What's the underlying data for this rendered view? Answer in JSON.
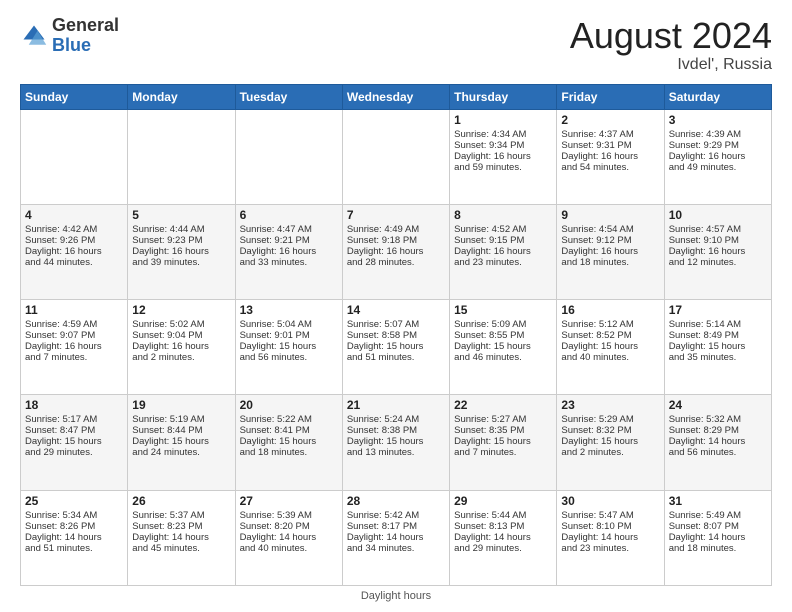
{
  "logo": {
    "general": "General",
    "blue": "Blue"
  },
  "header": {
    "month_year": "August 2024",
    "location": "Ivdel', Russia"
  },
  "footer": {
    "note": "Daylight hours"
  },
  "days_of_week": [
    "Sunday",
    "Monday",
    "Tuesday",
    "Wednesday",
    "Thursday",
    "Friday",
    "Saturday"
  ],
  "weeks": [
    [
      {
        "day": "",
        "info": ""
      },
      {
        "day": "",
        "info": ""
      },
      {
        "day": "",
        "info": ""
      },
      {
        "day": "",
        "info": ""
      },
      {
        "day": "1",
        "info": "Sunrise: 4:34 AM\nSunset: 9:34 PM\nDaylight: 16 hours\nand 59 minutes."
      },
      {
        "day": "2",
        "info": "Sunrise: 4:37 AM\nSunset: 9:31 PM\nDaylight: 16 hours\nand 54 minutes."
      },
      {
        "day": "3",
        "info": "Sunrise: 4:39 AM\nSunset: 9:29 PM\nDaylight: 16 hours\nand 49 minutes."
      }
    ],
    [
      {
        "day": "4",
        "info": "Sunrise: 4:42 AM\nSunset: 9:26 PM\nDaylight: 16 hours\nand 44 minutes."
      },
      {
        "day": "5",
        "info": "Sunrise: 4:44 AM\nSunset: 9:23 PM\nDaylight: 16 hours\nand 39 minutes."
      },
      {
        "day": "6",
        "info": "Sunrise: 4:47 AM\nSunset: 9:21 PM\nDaylight: 16 hours\nand 33 minutes."
      },
      {
        "day": "7",
        "info": "Sunrise: 4:49 AM\nSunset: 9:18 PM\nDaylight: 16 hours\nand 28 minutes."
      },
      {
        "day": "8",
        "info": "Sunrise: 4:52 AM\nSunset: 9:15 PM\nDaylight: 16 hours\nand 23 minutes."
      },
      {
        "day": "9",
        "info": "Sunrise: 4:54 AM\nSunset: 9:12 PM\nDaylight: 16 hours\nand 18 minutes."
      },
      {
        "day": "10",
        "info": "Sunrise: 4:57 AM\nSunset: 9:10 PM\nDaylight: 16 hours\nand 12 minutes."
      }
    ],
    [
      {
        "day": "11",
        "info": "Sunrise: 4:59 AM\nSunset: 9:07 PM\nDaylight: 16 hours\nand 7 minutes."
      },
      {
        "day": "12",
        "info": "Sunrise: 5:02 AM\nSunset: 9:04 PM\nDaylight: 16 hours\nand 2 minutes."
      },
      {
        "day": "13",
        "info": "Sunrise: 5:04 AM\nSunset: 9:01 PM\nDaylight: 15 hours\nand 56 minutes."
      },
      {
        "day": "14",
        "info": "Sunrise: 5:07 AM\nSunset: 8:58 PM\nDaylight: 15 hours\nand 51 minutes."
      },
      {
        "day": "15",
        "info": "Sunrise: 5:09 AM\nSunset: 8:55 PM\nDaylight: 15 hours\nand 46 minutes."
      },
      {
        "day": "16",
        "info": "Sunrise: 5:12 AM\nSunset: 8:52 PM\nDaylight: 15 hours\nand 40 minutes."
      },
      {
        "day": "17",
        "info": "Sunrise: 5:14 AM\nSunset: 8:49 PM\nDaylight: 15 hours\nand 35 minutes."
      }
    ],
    [
      {
        "day": "18",
        "info": "Sunrise: 5:17 AM\nSunset: 8:47 PM\nDaylight: 15 hours\nand 29 minutes."
      },
      {
        "day": "19",
        "info": "Sunrise: 5:19 AM\nSunset: 8:44 PM\nDaylight: 15 hours\nand 24 minutes."
      },
      {
        "day": "20",
        "info": "Sunrise: 5:22 AM\nSunset: 8:41 PM\nDaylight: 15 hours\nand 18 minutes."
      },
      {
        "day": "21",
        "info": "Sunrise: 5:24 AM\nSunset: 8:38 PM\nDaylight: 15 hours\nand 13 minutes."
      },
      {
        "day": "22",
        "info": "Sunrise: 5:27 AM\nSunset: 8:35 PM\nDaylight: 15 hours\nand 7 minutes."
      },
      {
        "day": "23",
        "info": "Sunrise: 5:29 AM\nSunset: 8:32 PM\nDaylight: 15 hours\nand 2 minutes."
      },
      {
        "day": "24",
        "info": "Sunrise: 5:32 AM\nSunset: 8:29 PM\nDaylight: 14 hours\nand 56 minutes."
      }
    ],
    [
      {
        "day": "25",
        "info": "Sunrise: 5:34 AM\nSunset: 8:26 PM\nDaylight: 14 hours\nand 51 minutes."
      },
      {
        "day": "26",
        "info": "Sunrise: 5:37 AM\nSunset: 8:23 PM\nDaylight: 14 hours\nand 45 minutes."
      },
      {
        "day": "27",
        "info": "Sunrise: 5:39 AM\nSunset: 8:20 PM\nDaylight: 14 hours\nand 40 minutes."
      },
      {
        "day": "28",
        "info": "Sunrise: 5:42 AM\nSunset: 8:17 PM\nDaylight: 14 hours\nand 34 minutes."
      },
      {
        "day": "29",
        "info": "Sunrise: 5:44 AM\nSunset: 8:13 PM\nDaylight: 14 hours\nand 29 minutes."
      },
      {
        "day": "30",
        "info": "Sunrise: 5:47 AM\nSunset: 8:10 PM\nDaylight: 14 hours\nand 23 minutes."
      },
      {
        "day": "31",
        "info": "Sunrise: 5:49 AM\nSunset: 8:07 PM\nDaylight: 14 hours\nand 18 minutes."
      }
    ]
  ]
}
